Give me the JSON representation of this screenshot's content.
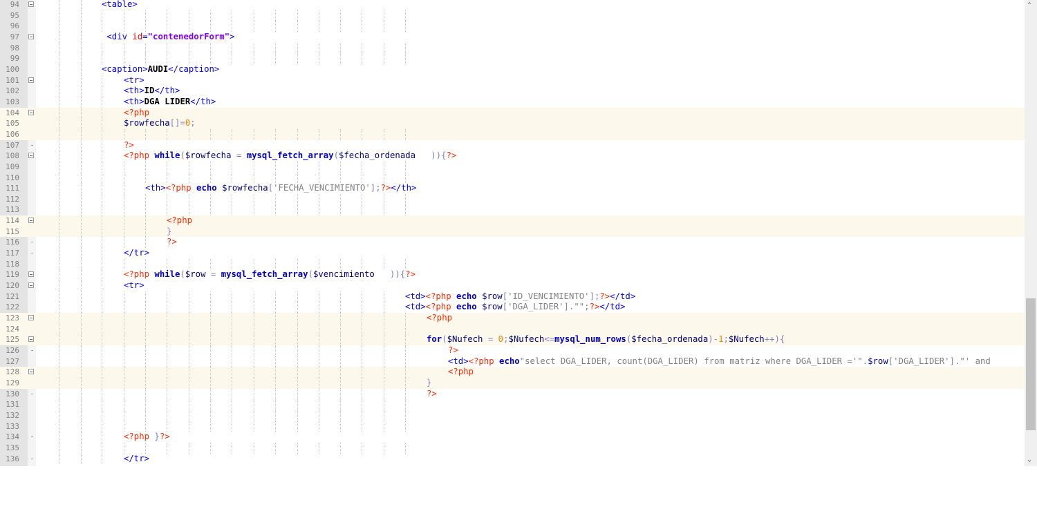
{
  "editor": {
    "lines": [
      {
        "n": "94",
        "fold": "marker",
        "indent": 3,
        "tokens": [
          [
            "tag",
            "<table>"
          ]
        ]
      },
      {
        "n": "95",
        "fold": "line",
        "indent": 0,
        "tokens": []
      },
      {
        "n": "96",
        "fold": "line",
        "indent": 0,
        "tokens": []
      },
      {
        "n": "97",
        "fold": "marker",
        "indent": 3,
        "tokens": [
          [
            "tag",
            " <div "
          ],
          [
            "attr",
            "id"
          ],
          [
            "tag",
            "="
          ],
          [
            "str",
            "\"contenedorForm\""
          ],
          [
            "tag",
            ">"
          ]
        ]
      },
      {
        "n": "98",
        "fold": "line",
        "indent": 0,
        "tokens": []
      },
      {
        "n": "99",
        "fold": "line",
        "indent": 0,
        "tokens": []
      },
      {
        "n": "100",
        "fold": "line",
        "indent": 3,
        "tokens": [
          [
            "tag",
            "<caption>"
          ],
          [
            "text",
            "AUDI"
          ],
          [
            "tag",
            "</caption>"
          ]
        ]
      },
      {
        "n": "101",
        "fold": "marker",
        "indent": 4,
        "tokens": [
          [
            "tag",
            "<tr>"
          ]
        ]
      },
      {
        "n": "102",
        "fold": "line",
        "indent": 4,
        "tokens": [
          [
            "tag",
            "<th>"
          ],
          [
            "text",
            "ID"
          ],
          [
            "tag",
            "</th>"
          ]
        ]
      },
      {
        "n": "103",
        "fold": "line",
        "indent": 4,
        "tokens": [
          [
            "tag",
            "<th>"
          ],
          [
            "text",
            "DGA LIDER"
          ],
          [
            "tag",
            "</th>"
          ]
        ]
      },
      {
        "n": "104",
        "fold": "marker",
        "hl": true,
        "indent": 4,
        "tokens": [
          [
            "php",
            "<?php"
          ]
        ]
      },
      {
        "n": "105",
        "fold": "line",
        "hl": true,
        "indent": 4,
        "tokens": [
          [
            "var",
            "$rowfecha"
          ],
          [
            "op",
            "[]="
          ],
          [
            "num",
            "0"
          ],
          [
            "op",
            ";"
          ]
        ]
      },
      {
        "n": "106",
        "fold": "line",
        "hl": true,
        "indent": 0,
        "tokens": []
      },
      {
        "n": "107",
        "fold": "end",
        "indent": 4,
        "tokens": [
          [
            "php",
            "?>"
          ]
        ]
      },
      {
        "n": "108",
        "fold": "marker",
        "indent": 4,
        "tokens": [
          [
            "php",
            "<?php "
          ],
          [
            "kw",
            "while"
          ],
          [
            "op",
            "("
          ],
          [
            "var",
            "$rowfecha"
          ],
          [
            "op",
            " = "
          ],
          [
            "kw",
            "mysql_fetch_array"
          ],
          [
            "op",
            "("
          ],
          [
            "var",
            "$fecha_ordenada   "
          ],
          [
            "op",
            "))"
          ],
          [
            "op",
            "{"
          ],
          [
            "php",
            "?>"
          ]
        ]
      },
      {
        "n": "109",
        "fold": "line",
        "indent": 0,
        "tokens": []
      },
      {
        "n": "110",
        "fold": "line",
        "indent": 0,
        "tokens": []
      },
      {
        "n": "111",
        "fold": "line",
        "indent": 5,
        "tokens": [
          [
            "tag",
            "<th>"
          ],
          [
            "php",
            "<?php "
          ],
          [
            "kw",
            "echo "
          ],
          [
            "var",
            "$rowfecha"
          ],
          [
            "op",
            "["
          ],
          [
            "phpstr",
            "'FECHA_VENCIMIENTO'"
          ],
          [
            "op",
            "];"
          ],
          [
            "php",
            "?>"
          ],
          [
            "tag",
            "</th>"
          ]
        ]
      },
      {
        "n": "112",
        "fold": "line",
        "indent": 0,
        "tokens": []
      },
      {
        "n": "113",
        "fold": "line",
        "indent": 0,
        "tokens": []
      },
      {
        "n": "114",
        "fold": "marker",
        "hl": true,
        "indent": 6,
        "tokens": [
          [
            "php",
            "<?php"
          ]
        ]
      },
      {
        "n": "115",
        "fold": "line",
        "hl": true,
        "indent": 6,
        "tokens": [
          [
            "op",
            "}"
          ]
        ]
      },
      {
        "n": "116",
        "fold": "end",
        "indent": 6,
        "tokens": [
          [
            "php",
            "?>"
          ]
        ]
      },
      {
        "n": "117",
        "fold": "end",
        "indent": 4,
        "tokens": [
          [
            "tag",
            "</tr>"
          ]
        ]
      },
      {
        "n": "118",
        "fold": "line",
        "indent": 0,
        "tokens": []
      },
      {
        "n": "119",
        "fold": "marker",
        "indent": 4,
        "tokens": [
          [
            "php",
            "<?php "
          ],
          [
            "kw",
            "while"
          ],
          [
            "op",
            "("
          ],
          [
            "var",
            "$row"
          ],
          [
            "op",
            " = "
          ],
          [
            "kw",
            "mysql_fetch_array"
          ],
          [
            "op",
            "("
          ],
          [
            "var",
            "$vencimiento   "
          ],
          [
            "op",
            "))"
          ],
          [
            "op",
            "{"
          ],
          [
            "php",
            "?>"
          ]
        ]
      },
      {
        "n": "120",
        "fold": "marker",
        "indent": 4,
        "tokens": [
          [
            "tag",
            "<tr>"
          ]
        ]
      },
      {
        "n": "121",
        "fold": "line",
        "indent": 18,
        "tokens": [
          [
            "tag",
            "<td>"
          ],
          [
            "php",
            "<?php "
          ],
          [
            "kw",
            "echo "
          ],
          [
            "var",
            "$row"
          ],
          [
            "op",
            "["
          ],
          [
            "phpstr",
            "'ID_VENCIMIENTO'"
          ],
          [
            "op",
            "];"
          ],
          [
            "php",
            "?>"
          ],
          [
            "tag",
            "</td>"
          ]
        ]
      },
      {
        "n": "122",
        "fold": "line",
        "indent": 18,
        "tokens": [
          [
            "tag",
            "<td>"
          ],
          [
            "php",
            "<?php "
          ],
          [
            "kw",
            "echo "
          ],
          [
            "var",
            "$row"
          ],
          [
            "op",
            "["
          ],
          [
            "phpstr",
            "'DGA_LIDER'"
          ],
          [
            "op",
            "]."
          ],
          [
            "phpstr",
            "\"\""
          ],
          [
            "op",
            ";"
          ],
          [
            "php",
            "?>"
          ],
          [
            "tag",
            "</td>"
          ]
        ]
      },
      {
        "n": "123",
        "fold": "marker",
        "hl": true,
        "indent": 19,
        "tokens": [
          [
            "php",
            "<?php"
          ]
        ]
      },
      {
        "n": "124",
        "fold": "line",
        "hl": true,
        "indent": 0,
        "tokens": []
      },
      {
        "n": "125",
        "fold": "marker",
        "hl": true,
        "indent": 19,
        "tokens": [
          [
            "kw",
            "for"
          ],
          [
            "op",
            "("
          ],
          [
            "var",
            "$Nufech"
          ],
          [
            "op",
            " = "
          ],
          [
            "num",
            "0"
          ],
          [
            "op",
            ";"
          ],
          [
            "var",
            "$Nufech"
          ],
          [
            "op",
            "<="
          ],
          [
            "kw",
            "mysql_num_rows"
          ],
          [
            "op",
            "("
          ],
          [
            "var",
            "$fecha_ordenada"
          ],
          [
            "op",
            ")-"
          ],
          [
            "num",
            "1"
          ],
          [
            "op",
            ";"
          ],
          [
            "var",
            "$Nufech"
          ],
          [
            "op",
            "++){"
          ]
        ]
      },
      {
        "n": "126",
        "fold": "end",
        "indent": 20,
        "tokens": [
          [
            "php",
            "?>"
          ]
        ]
      },
      {
        "n": "127",
        "fold": "line",
        "indent": 20,
        "tokens": [
          [
            "tag",
            "<td>"
          ],
          [
            "php",
            "<?php "
          ],
          [
            "kw",
            "echo"
          ],
          [
            "phpstr",
            "\"select DGA_LIDER, count(DGA_LIDER) from matriz where DGA_LIDER ='\""
          ],
          [
            "op",
            "."
          ],
          [
            "var",
            "$row"
          ],
          [
            "op",
            "["
          ],
          [
            "phpstr",
            "'DGA_LIDER'"
          ],
          [
            "op",
            "]."
          ],
          [
            "phpstr",
            "\"' and"
          ]
        ]
      },
      {
        "n": "128",
        "fold": "marker",
        "hl": true,
        "indent": 20,
        "tokens": [
          [
            "php",
            "<?php"
          ]
        ]
      },
      {
        "n": "129",
        "fold": "line",
        "hl": true,
        "indent": 19,
        "tokens": [
          [
            "op",
            "}"
          ]
        ]
      },
      {
        "n": "130",
        "fold": "end",
        "indent": 19,
        "tokens": [
          [
            "php",
            "?>"
          ]
        ]
      },
      {
        "n": "131",
        "fold": "line",
        "indent": 0,
        "tokens": []
      },
      {
        "n": "132",
        "fold": "line",
        "indent": 0,
        "tokens": []
      },
      {
        "n": "133",
        "fold": "line",
        "indent": 0,
        "tokens": []
      },
      {
        "n": "134",
        "fold": "end",
        "indent": 4,
        "tokens": [
          [
            "php",
            "<?php "
          ],
          [
            "op",
            "}"
          ],
          [
            "php",
            "?>"
          ]
        ]
      },
      {
        "n": "135",
        "fold": "line",
        "indent": 0,
        "tokens": []
      },
      {
        "n": "136",
        "fold": "end",
        "indent": 4,
        "tokens": [
          [
            "tag",
            "</tr>"
          ]
        ]
      }
    ]
  },
  "scrollbar": {
    "up_icon": "chevron-up-icon",
    "down_icon": "chevron-down-icon",
    "up_glyph": "⌃",
    "down_glyph": "⌄",
    "scroll_fraction": 0.68
  }
}
